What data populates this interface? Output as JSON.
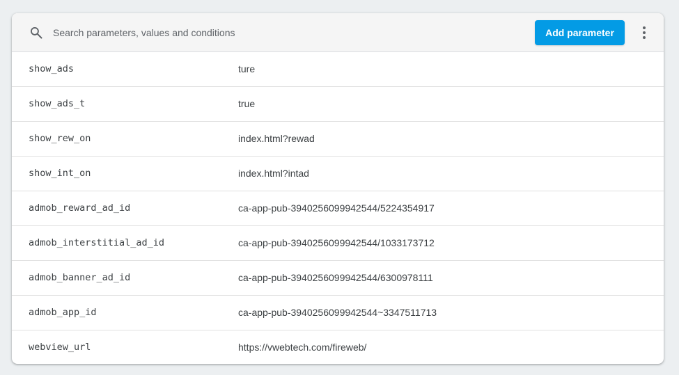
{
  "toolbar": {
    "search_placeholder": "Search parameters, values and conditions",
    "search_value": "",
    "add_label": "Add parameter",
    "search_icon": "search-icon",
    "more_icon": "more-vert-icon"
  },
  "colors": {
    "accent": "#039be5",
    "background": "#eceff1",
    "toolbar_bg": "#f5f5f5"
  },
  "parameters": [
    {
      "key": "show_ads",
      "value": "ture"
    },
    {
      "key": "show_ads_t",
      "value": "true"
    },
    {
      "key": "show_rew_on",
      "value": "index.html?rewad"
    },
    {
      "key": "show_int_on",
      "value": "index.html?intad"
    },
    {
      "key": "admob_reward_ad_id",
      "value": "ca-app-pub-3940256099942544/5224354917"
    },
    {
      "key": "admob_interstitial_ad_id",
      "value": "ca-app-pub-3940256099942544/1033173712"
    },
    {
      "key": "admob_banner_ad_id",
      "value": "ca-app-pub-3940256099942544/6300978111"
    },
    {
      "key": "admob_app_id",
      "value": "ca-app-pub-3940256099942544~3347511713"
    },
    {
      "key": "webview_url",
      "value": "https://vwebtech.com/fireweb/"
    }
  ]
}
